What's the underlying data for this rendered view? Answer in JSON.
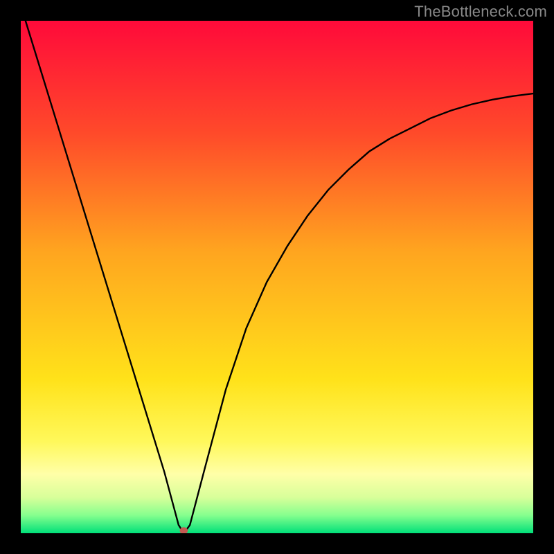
{
  "watermark": "TheBottleneck.com",
  "chart_data": {
    "type": "line",
    "title": "",
    "xlabel": "",
    "ylabel": "",
    "xlim": [
      0,
      100
    ],
    "ylim": [
      0,
      100
    ],
    "grid": false,
    "legend": false,
    "background_gradient": [
      {
        "offset": 0.0,
        "color": "#ff0a3a"
      },
      {
        "offset": 0.22,
        "color": "#ff4a2a"
      },
      {
        "offset": 0.45,
        "color": "#ffa51f"
      },
      {
        "offset": 0.7,
        "color": "#ffe21a"
      },
      {
        "offset": 0.82,
        "color": "#fff85a"
      },
      {
        "offset": 0.885,
        "color": "#ffffa8"
      },
      {
        "offset": 0.93,
        "color": "#d8ff9a"
      },
      {
        "offset": 0.965,
        "color": "#86ff8e"
      },
      {
        "offset": 1.0,
        "color": "#00e079"
      }
    ],
    "series": [
      {
        "name": "bottleneck-curve",
        "x": [
          0,
          4,
          8,
          12,
          16,
          20,
          24,
          28,
          30.8,
          31.5,
          32.2,
          33,
          36,
          40,
          44,
          48,
          52,
          56,
          60,
          64,
          68,
          72,
          76,
          80,
          84,
          88,
          92,
          96,
          100
        ],
        "y": [
          103,
          90,
          77,
          64,
          51,
          38,
          25,
          12,
          1.6,
          0.5,
          0.5,
          1.6,
          13,
          28,
          40,
          49,
          56,
          62,
          67,
          71,
          74.5,
          77,
          79,
          81,
          82.5,
          83.7,
          84.6,
          85.3,
          85.8
        ]
      }
    ],
    "marker": {
      "x": 31.8,
      "y": 0.5,
      "color": "#c35a52",
      "radius_px": 5
    }
  }
}
